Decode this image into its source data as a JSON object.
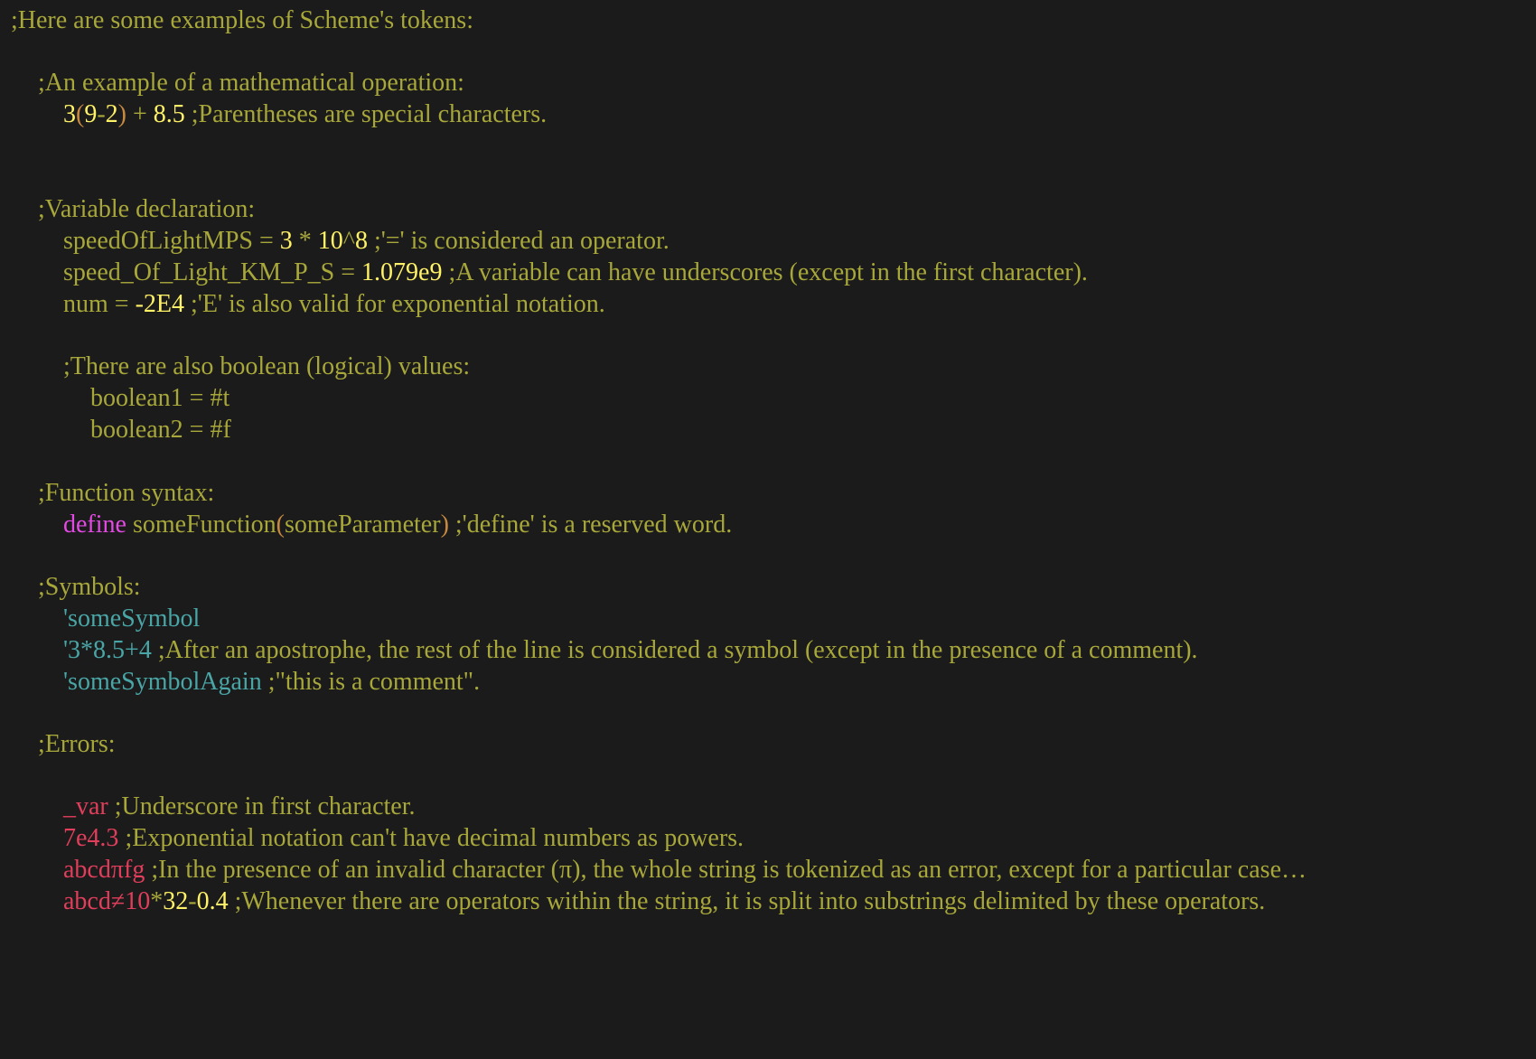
{
  "colors": {
    "background": "#1b1b1c",
    "comment": "#a8a73a",
    "number": "#fff267",
    "paren": "#c7893f",
    "operator": "#9a3fd0",
    "identifier": "#58b45e",
    "boolean": "#4f6fe0",
    "keyword": "#e349e3",
    "symbol": "#4aa6a6",
    "error": "#e03e5a"
  },
  "lines": [
    {
      "indent": 0,
      "tokens": [
        {
          "t": ";Here are some examples of Scheme's tokens:",
          "k": "comment"
        }
      ]
    },
    {
      "indent": 1,
      "tokens": [
        {
          "t": ";An example of a mathematical operation:",
          "k": "comment"
        }
      ]
    },
    {
      "indent": 2,
      "tokens": [
        {
          "t": "3",
          "k": "number"
        },
        {
          "t": "(",
          "k": "paren"
        },
        {
          "t": "9",
          "k": "number"
        },
        {
          "t": "-",
          "k": "operator"
        },
        {
          "t": "2",
          "k": "number"
        },
        {
          "t": ")",
          "k": "paren"
        },
        {
          "t": " + ",
          "k": "operator"
        },
        {
          "t": "8.5",
          "k": "number"
        },
        {
          "t": " ;Parentheses are special characters.",
          "k": "comment"
        }
      ]
    },
    {
      "indent": 1,
      "tokens": [
        {
          "t": ";Variable declaration:",
          "k": "comment"
        }
      ]
    },
    {
      "indent": 2,
      "tokens": [
        {
          "t": "speedOfLightMPS",
          "k": "identifier"
        },
        {
          "t": " = ",
          "k": "operator"
        },
        {
          "t": "3",
          "k": "number"
        },
        {
          "t": " * ",
          "k": "operator"
        },
        {
          "t": "10",
          "k": "number"
        },
        {
          "t": "^",
          "k": "operator"
        },
        {
          "t": "8",
          "k": "number"
        },
        {
          "t": " ;'=' is considered an operator.",
          "k": "comment"
        }
      ]
    },
    {
      "indent": 2,
      "tokens": [
        {
          "t": "speed_Of_Light_KM_P_S",
          "k": "identifier"
        },
        {
          "t": " = ",
          "k": "operator"
        },
        {
          "t": "1.079e9",
          "k": "number"
        },
        {
          "t": " ;A variable can have underscores (except in the first character).",
          "k": "comment"
        }
      ]
    },
    {
      "indent": 2,
      "tokens": [
        {
          "t": "num",
          "k": "identifier"
        },
        {
          "t": " = ",
          "k": "operator"
        },
        {
          "t": "-2E4",
          "k": "number"
        },
        {
          "t": " ;'E' is also valid for exponential notation.",
          "k": "comment"
        }
      ]
    },
    {
      "indent": 2,
      "tokens": [
        {
          "t": ";There are also boolean (logical) values:",
          "k": "comment"
        }
      ]
    },
    {
      "indent": 3,
      "tokens": [
        {
          "t": "boolean1",
          "k": "identifier"
        },
        {
          "t": " = ",
          "k": "operator"
        },
        {
          "t": "#t",
          "k": "boolean"
        }
      ]
    },
    {
      "indent": 3,
      "tokens": [
        {
          "t": "boolean2",
          "k": "identifier"
        },
        {
          "t": " = ",
          "k": "operator"
        },
        {
          "t": "#f",
          "k": "boolean"
        }
      ]
    },
    {
      "indent": 1,
      "tokens": [
        {
          "t": ";Function syntax:",
          "k": "comment"
        }
      ]
    },
    {
      "indent": 2,
      "tokens": [
        {
          "t": "define",
          "k": "keyword"
        },
        {
          "t": " ",
          "k": "comment"
        },
        {
          "t": "someFunction",
          "k": "identifier"
        },
        {
          "t": "(",
          "k": "paren"
        },
        {
          "t": "someParameter",
          "k": "identifier"
        },
        {
          "t": ")",
          "k": "paren"
        },
        {
          "t": " ;'define' is a reserved word.",
          "k": "comment"
        }
      ]
    },
    {
      "indent": 1,
      "tokens": [
        {
          "t": ";Symbols:",
          "k": "comment"
        }
      ]
    },
    {
      "indent": 2,
      "tokens": [
        {
          "t": "'someSymbol",
          "k": "symbol"
        }
      ]
    },
    {
      "indent": 2,
      "tokens": [
        {
          "t": "'3*8.5+4",
          "k": "symbol"
        },
        {
          "t": " ;After an apostrophe, the rest of the line is considered a symbol (except in the presence of a comment).",
          "k": "comment"
        }
      ]
    },
    {
      "indent": 2,
      "tokens": [
        {
          "t": "'someSymbolAgain",
          "k": "symbol"
        },
        {
          "t": " ;\"this is a comment\".",
          "k": "comment"
        }
      ]
    },
    {
      "indent": 1,
      "tokens": [
        {
          "t": ";Errors:",
          "k": "comment"
        }
      ]
    },
    {
      "indent": 2,
      "tokens": [
        {
          "t": "_var",
          "k": "error"
        },
        {
          "t": " ;Underscore in first character.",
          "k": "comment"
        }
      ]
    },
    {
      "indent": 2,
      "tokens": [
        {
          "t": "7e4.3",
          "k": "error"
        },
        {
          "t": " ;Exponential notation can't have decimal numbers as powers.",
          "k": "comment"
        }
      ]
    },
    {
      "indent": 2,
      "tokens": [
        {
          "t": "abcdπfg",
          "k": "error"
        },
        {
          "t": " ;In the presence of an invalid character (π), the whole string is tokenized as an error, except for a particular case…",
          "k": "comment"
        }
      ]
    },
    {
      "indent": 2,
      "tokens": [
        {
          "t": "abcd≠10",
          "k": "error"
        },
        {
          "t": "*",
          "k": "operator"
        },
        {
          "t": "32",
          "k": "number"
        },
        {
          "t": "-",
          "k": "operator"
        },
        {
          "t": "0.4",
          "k": "number"
        },
        {
          "t": " ;Whenever there are operators within the string, it is split into substrings delimited by these operators.",
          "k": "comment"
        }
      ]
    }
  ]
}
